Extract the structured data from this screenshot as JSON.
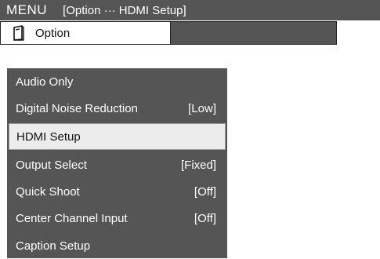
{
  "header": {
    "menu_label": "MENU",
    "breadcrumb": "[Option ··· HDMI Setup]"
  },
  "tabs": [
    {
      "label": "Option",
      "icon": "remote-icon"
    }
  ],
  "menu": {
    "items": [
      {
        "label": "Audio Only",
        "value": ""
      },
      {
        "label": "Digital Noise Reduction",
        "value": "[Low]"
      },
      {
        "label": "HDMI Setup",
        "value": "",
        "selected": true
      },
      {
        "label": "Output Select",
        "value": "[Fixed]"
      },
      {
        "label": "Quick Shoot",
        "value": "[Off]"
      },
      {
        "label": "Center Channel Input",
        "value": "[Off]"
      },
      {
        "label": "Caption Setup",
        "value": ""
      }
    ]
  },
  "colors": {
    "panel": "#555555",
    "highlight": "#ececec",
    "text_light": "#ffffff",
    "text_dark": "#111111"
  }
}
